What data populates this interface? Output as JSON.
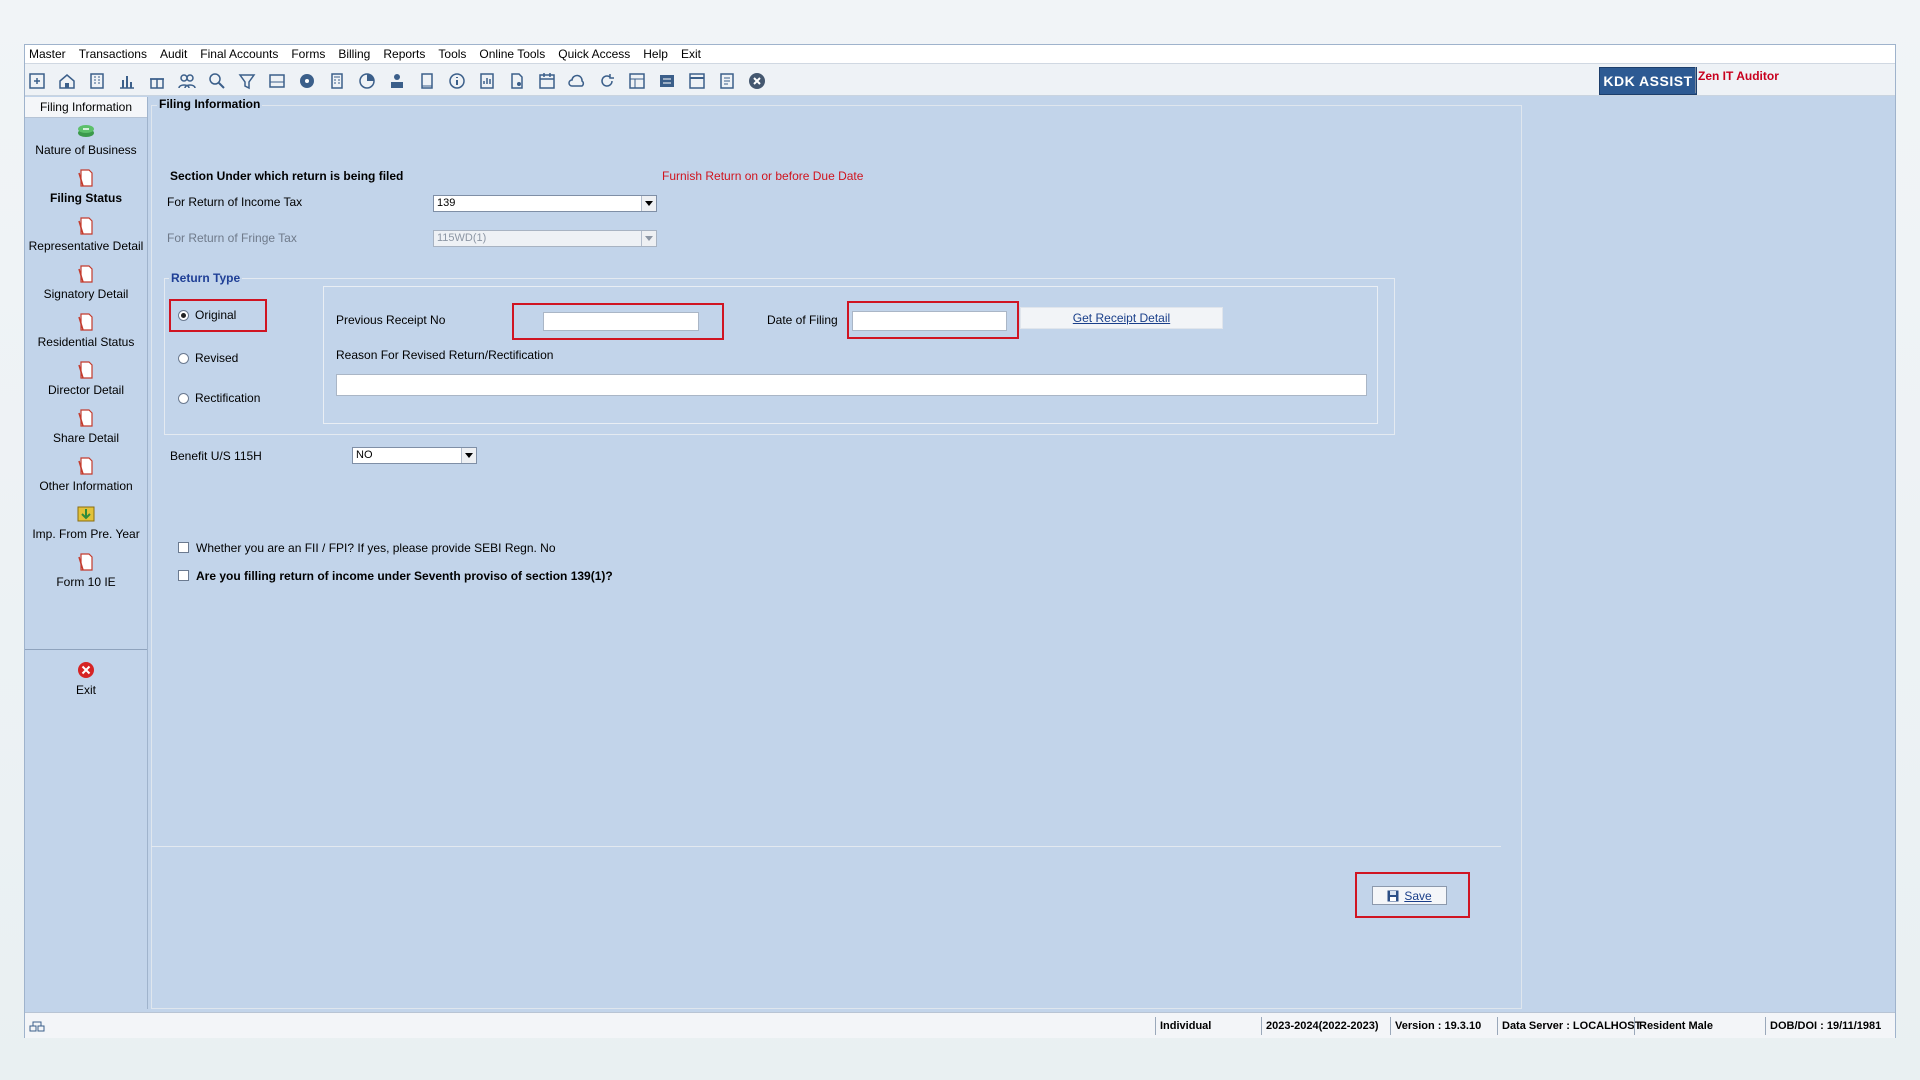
{
  "menu": [
    {
      "label": "Master"
    },
    {
      "label": "Transactions"
    },
    {
      "label": "Audit"
    },
    {
      "label": "Final Accounts"
    },
    {
      "label": "Forms"
    },
    {
      "label": "Billing"
    },
    {
      "label": "Reports"
    },
    {
      "label": "Tools"
    },
    {
      "label": "Online Tools"
    },
    {
      "label": "Quick Access"
    },
    {
      "label": "Help"
    },
    {
      "label": "Exit"
    }
  ],
  "toolbar": {
    "icons": [
      "file-open-icon",
      "home-icon",
      "building-icon",
      "bar-chart-icon",
      "gift-icon",
      "users-icon",
      "magnifier-icon",
      "filter-icon",
      "tax-icon",
      "disc-icon",
      "calculator-icon",
      "pie-chart-icon",
      "pay-icon",
      "book-icon",
      "info-icon",
      "report-icon",
      "document-user-icon",
      "calendar-icon",
      "cloud-icon",
      "refresh-icon",
      "grid-icon",
      "bs-icon",
      "scd-icon",
      "sheet-icon",
      "close-circle-icon"
    ],
    "logo": "KDK ASSIST",
    "product": "Zen IT Auditor"
  },
  "sidebar": {
    "header": "Filing Information",
    "items": [
      {
        "label": "Nature of Business",
        "icon": "money-stack-icon"
      },
      {
        "label": "Filing Status",
        "icon": "document-icon",
        "active": true
      },
      {
        "label": "Representative Detail",
        "icon": "document-icon"
      },
      {
        "label": "Signatory Detail",
        "icon": "document-icon"
      },
      {
        "label": "Residential Status",
        "icon": "document-icon"
      },
      {
        "label": "Director Detail",
        "icon": "document-icon"
      },
      {
        "label": "Share Detail",
        "icon": "document-icon"
      },
      {
        "label": "Other Information",
        "icon": "document-icon"
      },
      {
        "label": "Imp. From Pre. Year",
        "icon": "import-icon"
      },
      {
        "label": "Form 10 IE",
        "icon": "document-icon"
      }
    ],
    "exit_label": "Exit"
  },
  "content": {
    "title": "Filing Information",
    "section_heading": "Section Under which return is being filed",
    "notice": "Furnish Return on or before Due Date",
    "income_tax_label": "For Return of Income Tax",
    "income_tax_value": "139",
    "fringe_tax_label": "For Return of Fringe Tax",
    "fringe_tax_value": "115WD(1)",
    "return_type_heading": "Return Type",
    "radio_original": "Original",
    "radio_revised": "Revised",
    "radio_rectification": "Rectification",
    "prev_receipt_label": "Previous Receipt No",
    "prev_receipt_value": "",
    "date_filing_label": "Date of Filing",
    "date_filing_value": "",
    "get_receipt_button": "Get Receipt Detail",
    "reason_label": "Reason For Revised Return/Rectification",
    "reason_value": "",
    "benefit_label": "Benefit U/S 115H",
    "benefit_value": "NO",
    "fii_label": "Whether you are an FII / FPI?  If yes, please provide SEBI Regn. No",
    "seventh_proviso_label": "Are you filling return of income under Seventh proviso of section 139(1)?",
    "save_button": "Save"
  },
  "status": {
    "type": "Individual",
    "year": "2023-2024(2022-2023)",
    "version": "Version : 19.3.10",
    "server": "Data Server : LOCALHOST",
    "resident": "Resident Male",
    "dob": "DOB/DOI : 19/11/1981"
  },
  "colors": {
    "background": "#c2d4ea",
    "accent_red": "#d01422",
    "logo_blue": "#2d5a93",
    "link_blue": "#1a3f8a"
  }
}
